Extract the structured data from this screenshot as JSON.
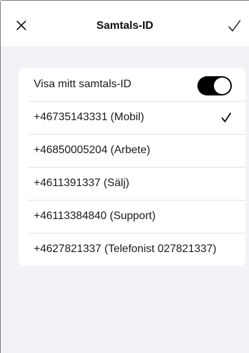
{
  "header": {
    "title": "Samtals-ID",
    "close_icon": "close-icon",
    "done_icon": "checkmark-icon"
  },
  "settings": {
    "show_caller_id": {
      "label": "Visa mitt samtals-ID",
      "enabled": true
    },
    "numbers": [
      {
        "label": "+46735143331 (Mobil)",
        "selected": true
      },
      {
        "label": "+46850005204 (Arbete)",
        "selected": false
      },
      {
        "label": "+4611391337 (Sälj)",
        "selected": false
      },
      {
        "label": "+46113384840 (Support)",
        "selected": false
      },
      {
        "label": "+4627821337 (Telefonist 027821337)",
        "selected": false
      }
    ]
  },
  "colors": {
    "background": "#f2f2f7",
    "card": "#ffffff",
    "toggle_on": "#000000"
  }
}
